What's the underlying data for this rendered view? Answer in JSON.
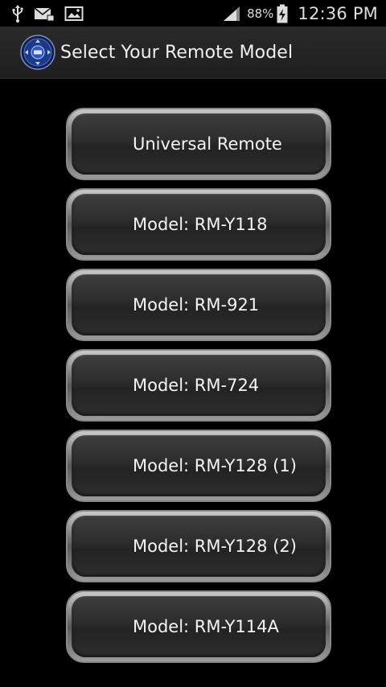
{
  "status_bar": {
    "battery_percent": "88%",
    "time": "12:36 PM",
    "icons": [
      "usb-icon",
      "mail-icon",
      "image-icon",
      "signal-icon",
      "battery-charging-icon"
    ]
  },
  "action_bar": {
    "title": "Select Your Remote Model",
    "app_icon": "remote-app-icon"
  },
  "models": [
    {
      "label": "Universal Remote"
    },
    {
      "label": "Model: RM-Y118"
    },
    {
      "label": "Model: RM-921"
    },
    {
      "label": "Model: RM-724"
    },
    {
      "label": "Model: RM-Y128 (1)"
    },
    {
      "label": "Model: RM-Y128 (2)"
    },
    {
      "label": "Model: RM-Y114A"
    }
  ],
  "colors": {
    "background": "#000000",
    "action_bar": "#242424",
    "button_face": "#2c2c2c",
    "button_border": "#8a8a8a",
    "text": "#f4f4f4"
  }
}
